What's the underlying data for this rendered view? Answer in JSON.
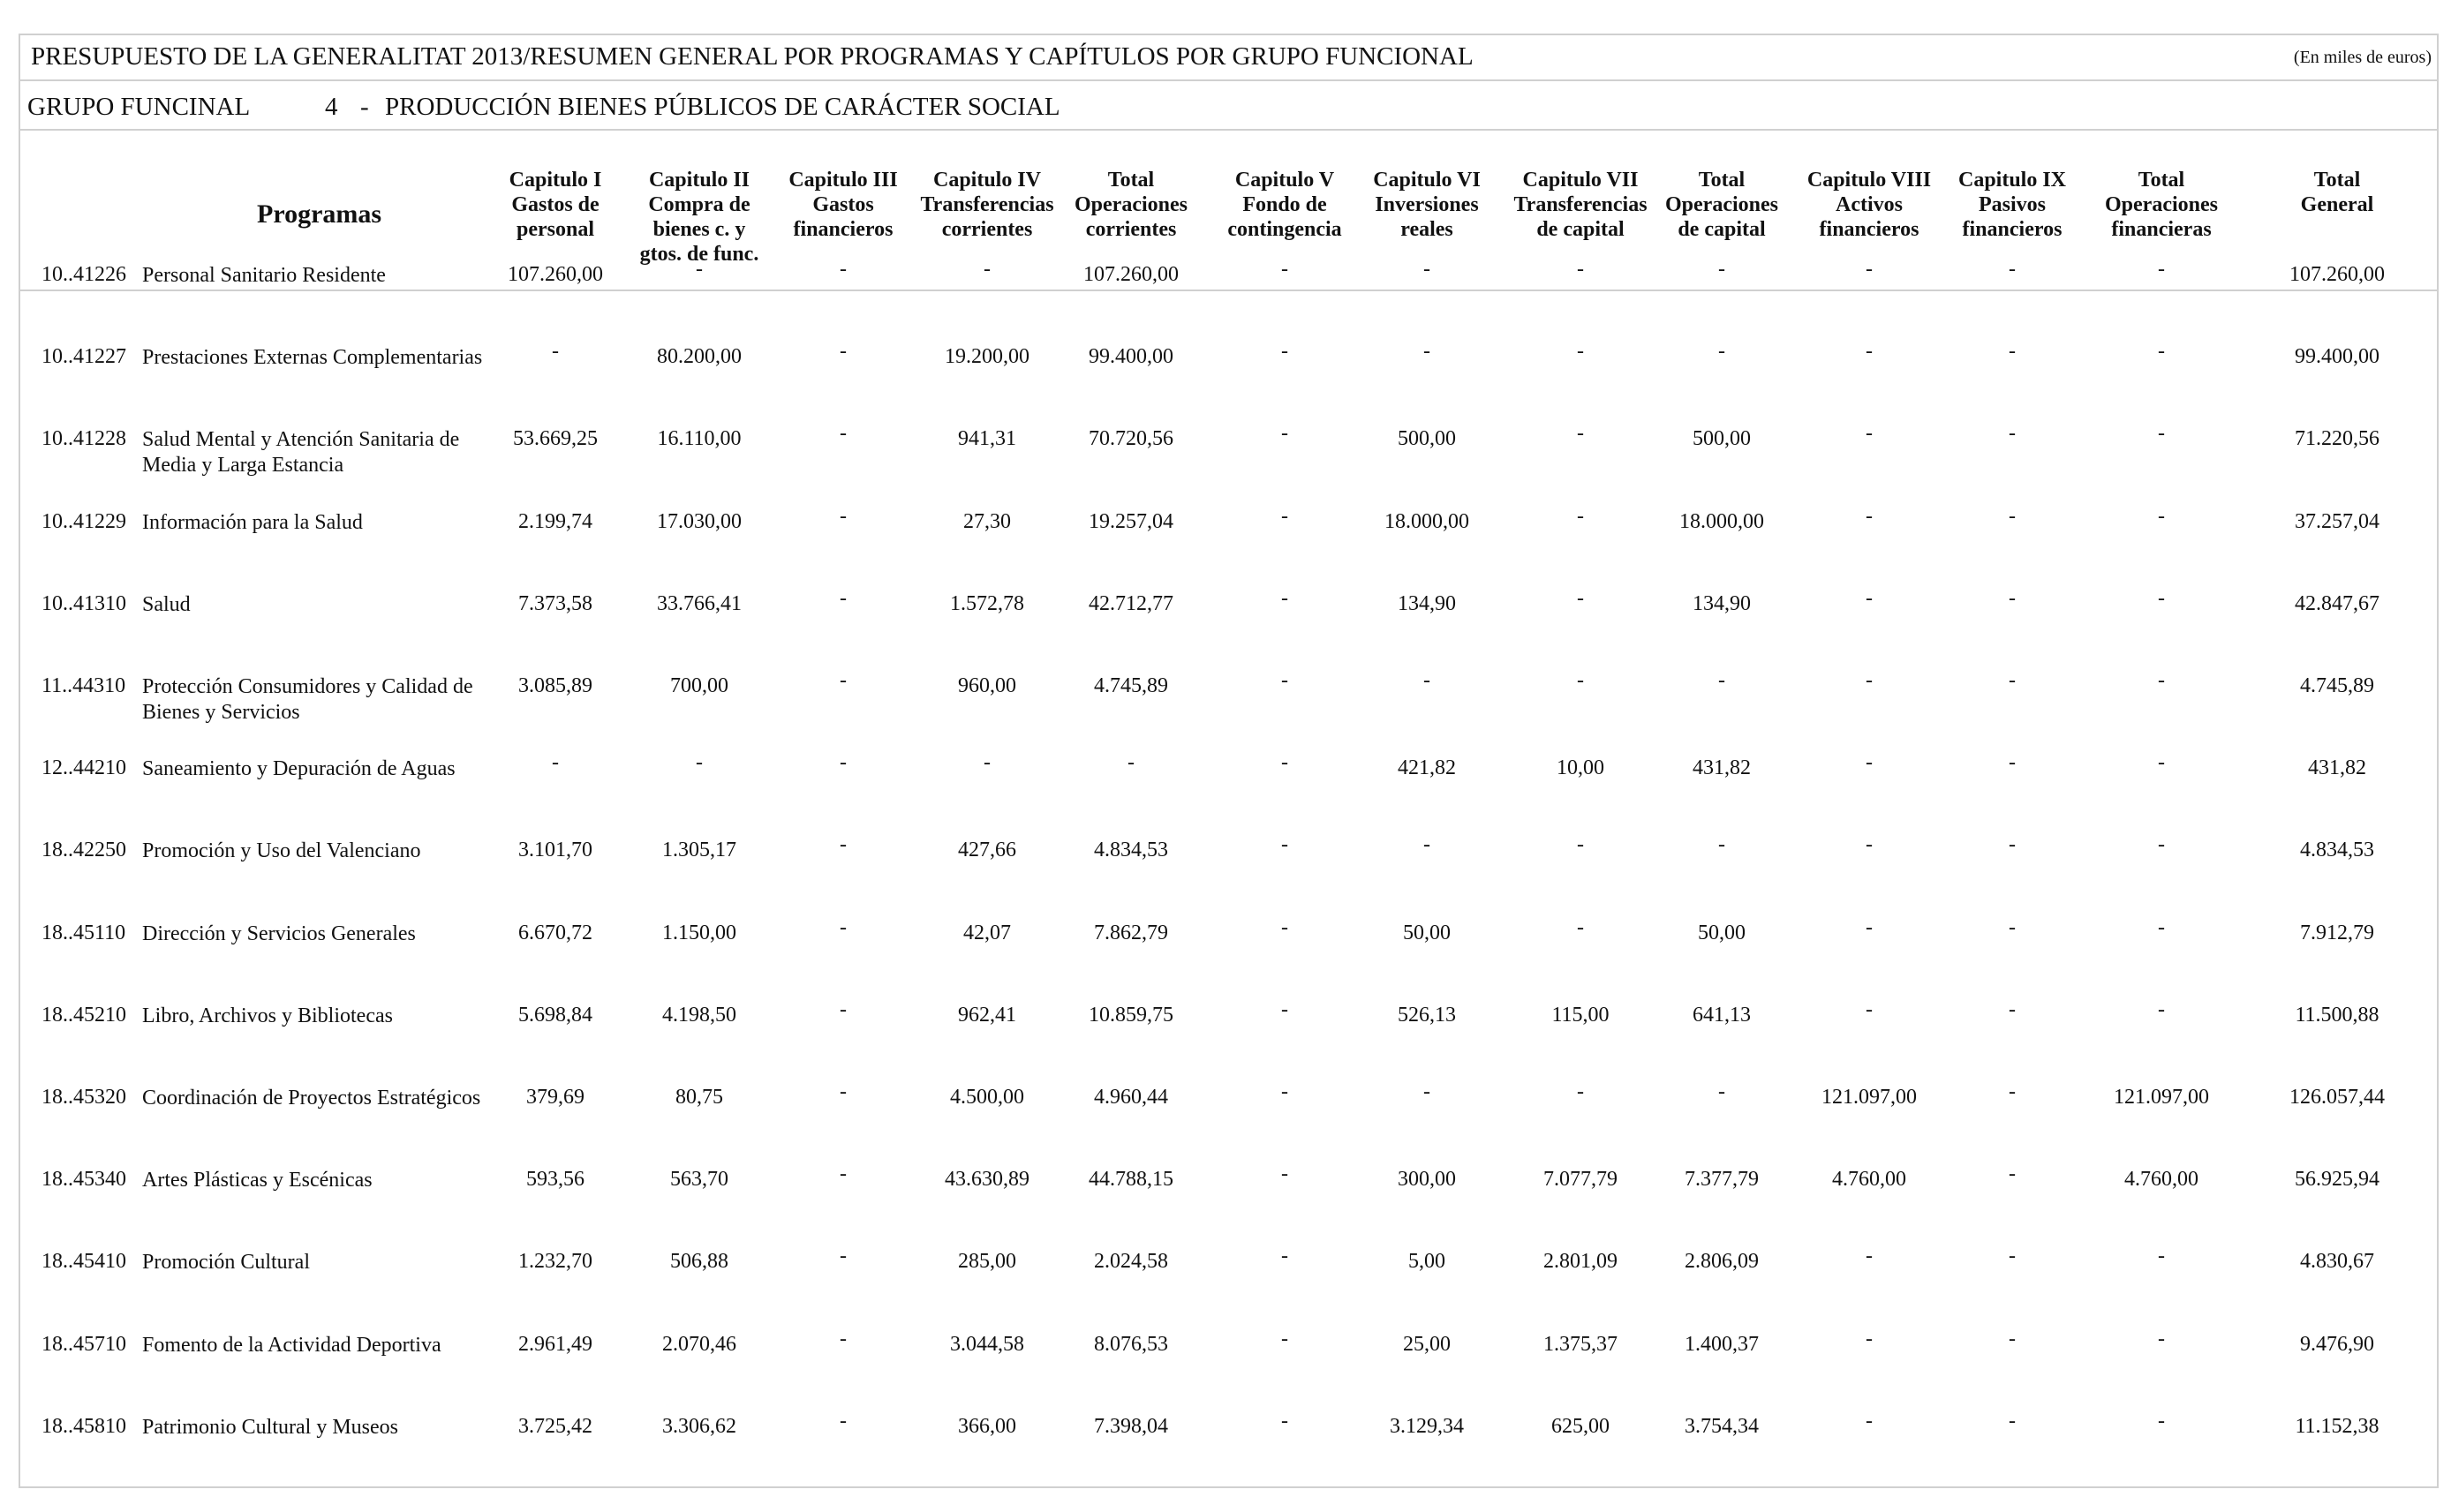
{
  "document": {
    "title": "PRESUPUESTO DE LA GENERALITAT 2013/RESUMEN GENERAL POR PROGRAMAS Y CAPÍTULOS POR GRUPO FUNCIONAL",
    "units_note": "(En miles de euros)",
    "group_label": "GRUPO FUNCINAL",
    "group_number": "4",
    "group_dash": "-",
    "group_name": "PRODUCCIÓN BIENES PÚBLICOS DE CARÁCTER SOCIAL"
  },
  "table": {
    "programs_header": "Programas",
    "columns": [
      "Capitulo I\nGastos de\npersonal",
      "Capitulo II\nCompra de\nbienes c. y\ngtos. de func.",
      "Capitulo III\nGastos\nfinancieros",
      "Capitulo IV\nTransferencias\ncorrientes",
      "Total\nOperaciones\ncorrientes",
      "Capitulo V\nFondo de\ncontingencia",
      "Capitulo VI\nInversiones\nreales",
      "Capitulo VII\nTransferencias\nde capital",
      "Total\nOperaciones\nde capital",
      "Capitulo VIII\nActivos\nfinancieros",
      "Capitulo IX\nPasivos\nfinancieros",
      "Total\nOperaciones\nfinancieras",
      "Total General"
    ],
    "rows": [
      {
        "code": "10..41226",
        "name": "Personal Sanitario Residente",
        "values": [
          "107.260,00",
          "-",
          "-",
          "-",
          "107.260,00",
          "-",
          "-",
          "-",
          "-",
          "-",
          "-",
          "-",
          "107.260,00"
        ]
      },
      {
        "code": "10..41227",
        "name": "Prestaciones  Externas Complementarias",
        "values": [
          "-",
          "80.200,00",
          "-",
          "19.200,00",
          "99.400,00",
          "-",
          "-",
          "-",
          "-",
          "-",
          "-",
          "-",
          "99.400,00"
        ]
      },
      {
        "code": "10..41228",
        "name": "Salud Mental y Atención Sanitaria de Media y Larga Estancia",
        "values": [
          "53.669,25",
          "16.110,00",
          "-",
          "941,31",
          "70.720,56",
          "-",
          "500,00",
          "-",
          "500,00",
          "-",
          "-",
          "-",
          "71.220,56"
        ]
      },
      {
        "code": "10..41229",
        "name": "Información para la Salud",
        "values": [
          "2.199,74",
          "17.030,00",
          "-",
          "27,30",
          "19.257,04",
          "-",
          "18.000,00",
          "-",
          "18.000,00",
          "-",
          "-",
          "-",
          "37.257,04"
        ]
      },
      {
        "code": "10..41310",
        "name": "Salud",
        "values": [
          "7.373,58",
          "33.766,41",
          "-",
          "1.572,78",
          "42.712,77",
          "-",
          "134,90",
          "-",
          "134,90",
          "-",
          "-",
          "-",
          "42.847,67"
        ]
      },
      {
        "code": "11..44310",
        "name": "Protección Consumidores y Calidad de Bienes y Servicios",
        "values": [
          "3.085,89",
          "700,00",
          "-",
          "960,00",
          "4.745,89",
          "-",
          "-",
          "-",
          "-",
          "-",
          "-",
          "-",
          "4.745,89"
        ]
      },
      {
        "code": "12..44210",
        "name": "Saneamiento y Depuración de Aguas",
        "values": [
          "-",
          "-",
          "-",
          "-",
          "-",
          "-",
          "421,82",
          "10,00",
          "431,82",
          "-",
          "-",
          "-",
          "431,82"
        ]
      },
      {
        "code": "18..42250",
        "name": "Promoción y Uso del Valenciano",
        "values": [
          "3.101,70",
          "1.305,17",
          "-",
          "427,66",
          "4.834,53",
          "-",
          "-",
          "-",
          "-",
          "-",
          "-",
          "-",
          "4.834,53"
        ]
      },
      {
        "code": "18..45110",
        "name": "Dirección y Servicios Generales",
        "values": [
          "6.670,72",
          "1.150,00",
          "-",
          "42,07",
          "7.862,79",
          "-",
          "50,00",
          "-",
          "50,00",
          "-",
          "-",
          "-",
          "7.912,79"
        ]
      },
      {
        "code": "18..45210",
        "name": "Libro, Archivos y Bibliotecas",
        "values": [
          "5.698,84",
          "4.198,50",
          "-",
          "962,41",
          "10.859,75",
          "-",
          "526,13",
          "115,00",
          "641,13",
          "-",
          "-",
          "-",
          "11.500,88"
        ]
      },
      {
        "code": "18..45320",
        "name": "Coordinación de Proyectos Estratégicos",
        "values": [
          "379,69",
          "80,75",
          "-",
          "4.500,00",
          "4.960,44",
          "-",
          "-",
          "-",
          "-",
          "121.097,00",
          "-",
          "121.097,00",
          "126.057,44"
        ]
      },
      {
        "code": "18..45340",
        "name": "Artes Plásticas y Escénicas",
        "values": [
          "593,56",
          "563,70",
          "-",
          "43.630,89",
          "44.788,15",
          "-",
          "300,00",
          "7.077,79",
          "7.377,79",
          "4.760,00",
          "-",
          "4.760,00",
          "56.925,94"
        ]
      },
      {
        "code": "18..45410",
        "name": "Promoción Cultural",
        "values": [
          "1.232,70",
          "506,88",
          "-",
          "285,00",
          "2.024,58",
          "-",
          "5,00",
          "2.801,09",
          "2.806,09",
          "-",
          "-",
          "-",
          "4.830,67"
        ]
      },
      {
        "code": "18..45710",
        "name": "Fomento de la Actividad Deportiva",
        "values": [
          "2.961,49",
          "2.070,46",
          "-",
          "3.044,58",
          "8.076,53",
          "-",
          "25,00",
          "1.375,37",
          "1.400,37",
          "-",
          "-",
          "-",
          "9.476,90"
        ]
      },
      {
        "code": "18..45810",
        "name": "Patrimonio Cultural y Museos",
        "values": [
          "3.725,42",
          "3.306,62",
          "-",
          "366,00",
          "7.398,04",
          "-",
          "3.129,34",
          "625,00",
          "3.754,34",
          "-",
          "-",
          "-",
          "11.152,38"
        ]
      }
    ]
  }
}
